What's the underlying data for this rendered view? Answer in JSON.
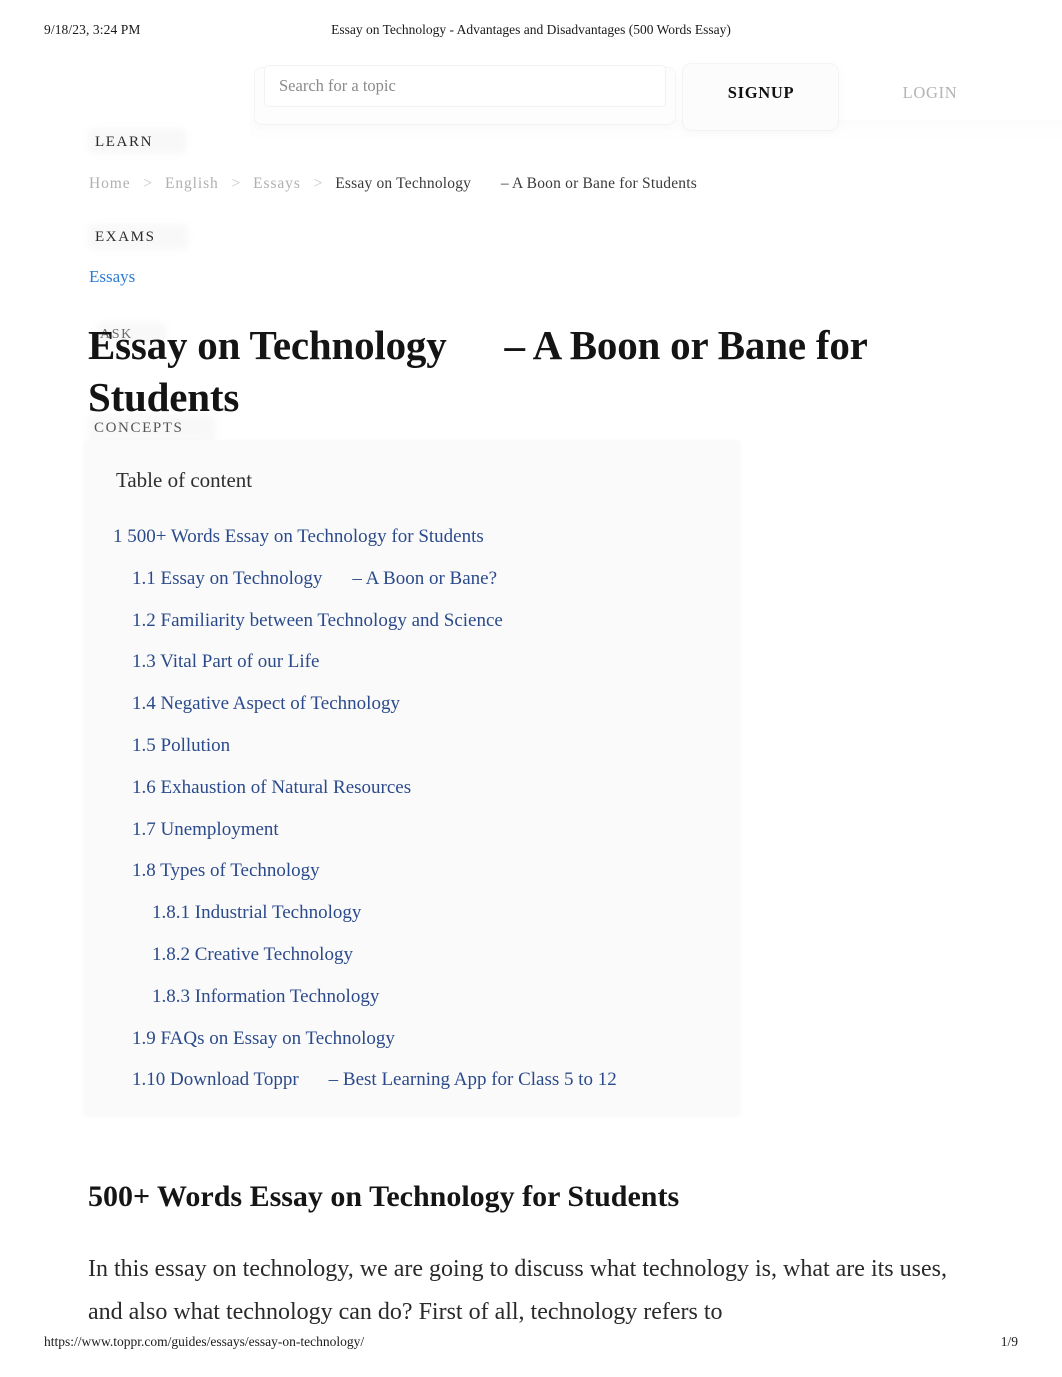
{
  "print_header": {
    "date": "9/18/23, 3:24 PM",
    "doc_title": "Essay on Technology - Advantages and Disadvantages (500 Words Essay)"
  },
  "topbar": {
    "search_placeholder": "Search for a topic",
    "search_value": "",
    "signup_label": "SIGNUP",
    "login_label": "LOGIN"
  },
  "sidebar": {
    "items": [
      {
        "label": "LEARN"
      },
      {
        "label": "EXAMS"
      },
      {
        "label": "ASK"
      },
      {
        "label": "CONCEPTS"
      }
    ]
  },
  "breadcrumb": {
    "items": [
      {
        "label": "Home"
      },
      {
        "label": "English"
      },
      {
        "label": "Essays"
      }
    ],
    "separator": ">",
    "current": "Essay on Technology",
    "current_tail": "– A Boon or Bane for Students"
  },
  "article": {
    "category": "Essays",
    "title_part1": "Essay on Technology",
    "title_part2": "– A Boon or Bane for Students"
  },
  "toc": {
    "heading": "Table of content",
    "items": [
      {
        "number": "1",
        "text": "500+ Words Essay on Technology for Students",
        "level": 1
      },
      {
        "number": "1.1",
        "text": "Essay on Technology",
        "tail": "– A Boon or Bane?",
        "level": 2
      },
      {
        "number": "1.2",
        "text": "Familiarity between Technology and Science",
        "level": 2
      },
      {
        "number": "1.3",
        "text": "Vital Part of our Life",
        "level": 2
      },
      {
        "number": "1.4",
        "text": "Negative Aspect of Technology",
        "level": 2
      },
      {
        "number": "1.5",
        "text": "Pollution",
        "level": 2
      },
      {
        "number": "1.6",
        "text": "Exhaustion of Natural Resources",
        "level": 2
      },
      {
        "number": "1.7",
        "text": "Unemployment",
        "level": 2
      },
      {
        "number": "1.8",
        "text": "Types of Technology",
        "level": 2
      },
      {
        "number": "1.8.1",
        "text": "Industrial Technology",
        "level": 3
      },
      {
        "number": "1.8.2",
        "text": "Creative Technology",
        "level": 3
      },
      {
        "number": "1.8.3",
        "text": "Information Technology",
        "level": 3
      },
      {
        "number": "1.9",
        "text": "FAQs on Essay on Technology",
        "level": 2
      },
      {
        "number": "1.10",
        "text": "Download Toppr",
        "tail": "– Best Learning App for Class 5 to 12",
        "level": 2
      }
    ]
  },
  "body": {
    "section_heading": "500+ Words Essay on Technology for Students",
    "paragraph": "In this essay on technology, we are going to discuss what technology is, what are its uses, and also what technology can do? First of all, technology refers to"
  },
  "print_footer": {
    "url": "https://www.toppr.com/guides/essays/essay-on-technology/",
    "page": "1/9"
  },
  "colors": {
    "toc_link": "#2b4a8b",
    "category_link": "#2b7cd3",
    "breadcrumb_link": "#b0b0b0",
    "text": "#2a2a2a"
  }
}
